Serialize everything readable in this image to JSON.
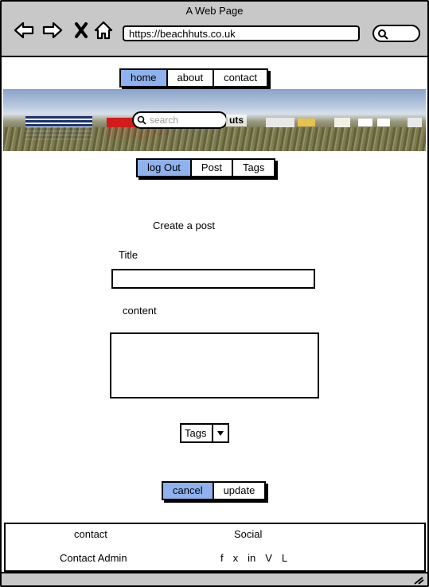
{
  "browser": {
    "title": "A Web Page",
    "url": "https://beachhuts.co.uk",
    "icons": [
      "back-arrow-icon",
      "forward-arrow-icon",
      "close-icon",
      "home-icon",
      "search-icon"
    ]
  },
  "topnav": {
    "items": [
      {
        "label": "home",
        "active": true
      },
      {
        "label": "about"
      },
      {
        "label": "contact"
      }
    ]
  },
  "hero": {
    "search_placeholder": "search",
    "label_fragment": "uts"
  },
  "subnav": {
    "items": [
      {
        "label": "log Out",
        "active": true
      },
      {
        "label": "Post"
      },
      {
        "label": "Tags"
      }
    ]
  },
  "form": {
    "heading": "Create a post",
    "title_label": "Title",
    "title_value": "",
    "content_label": "content",
    "content_value": "",
    "tags_select": "Tags"
  },
  "actions": {
    "cancel": "cancel",
    "update": "update"
  },
  "footer": {
    "contact_heading": "contact",
    "social_heading": "Social",
    "contact_link": "Contact Admin",
    "social_links": [
      "f",
      "x",
      "in",
      "V",
      "L"
    ]
  },
  "colors": {
    "active_tab": "#8fb2ee",
    "chrome": "#c8c8c8"
  }
}
